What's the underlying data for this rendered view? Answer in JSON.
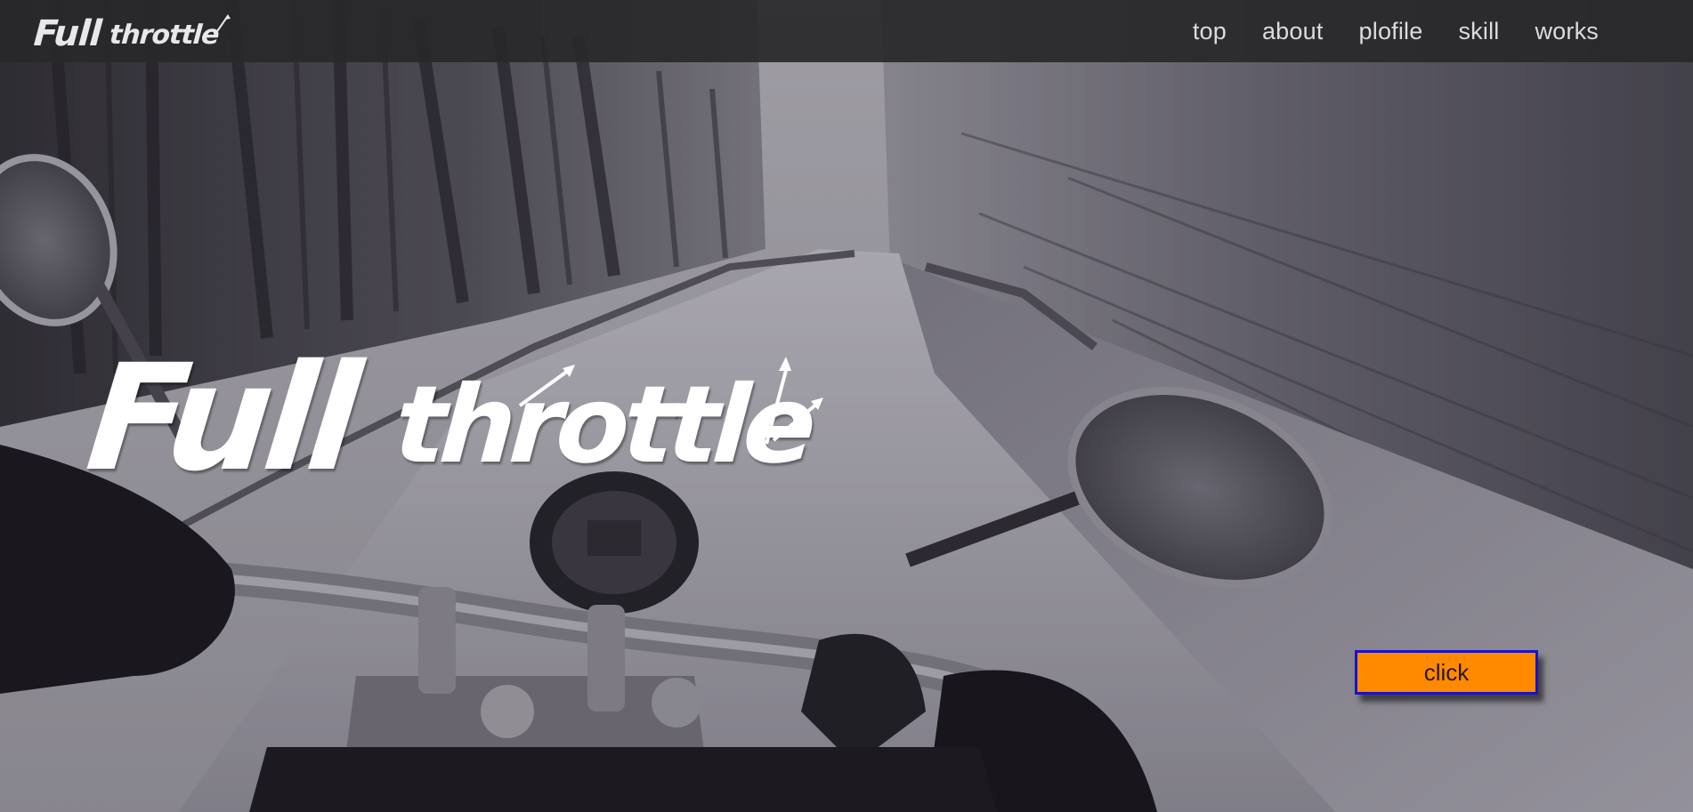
{
  "header": {
    "logo_word_1": "Full",
    "logo_word_2": "throttle"
  },
  "nav": {
    "items": [
      {
        "label": "top"
      },
      {
        "label": "about"
      },
      {
        "label": "plofile"
      },
      {
        "label": "skill"
      },
      {
        "label": "works"
      }
    ]
  },
  "hero": {
    "title_word_1": "Full",
    "title_word_2": "throttle",
    "background": "motorcycle-on-snowy-forest-road-photo"
  },
  "cta": {
    "label": "click",
    "color": "#ff8a00",
    "border_color": "#1a12c8"
  }
}
